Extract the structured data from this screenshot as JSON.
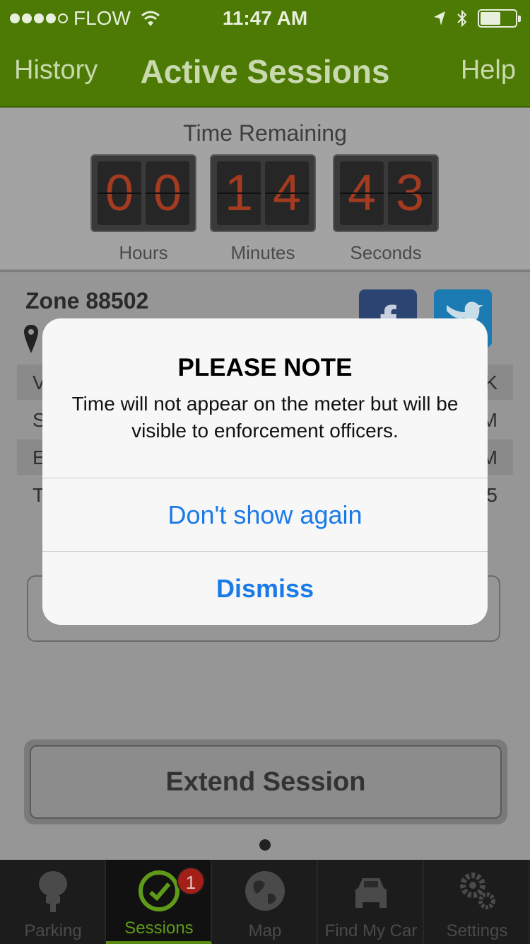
{
  "status_bar": {
    "carrier": "FLOW",
    "time": "11:47 AM",
    "signal_bars_filled": 4,
    "signal_bars_total": 5
  },
  "nav": {
    "left": "History",
    "title": "Active Sessions",
    "right": "Help"
  },
  "timer": {
    "heading": "Time Remaining",
    "hours": [
      "0",
      "0"
    ],
    "minutes": [
      "1",
      "4"
    ],
    "seconds": [
      "4",
      "3"
    ],
    "hours_label": "Hours",
    "minutes_label": "Minutes",
    "seconds_label": "Seconds"
  },
  "session": {
    "zone": "Zone 88502",
    "row_fragments": [
      {
        "left": "V",
        "right": "K"
      },
      {
        "left": "S",
        "right": "M"
      },
      {
        "left": "E",
        "right": "M"
      },
      {
        "left": "T",
        "right": "5"
      }
    ],
    "facebook_letter": "f"
  },
  "actions": {
    "extend": "Extend Session"
  },
  "alert": {
    "title": "PLEASE NOTE",
    "message": "Time will not appear on the meter but will be visible to enforcement officers.",
    "button_secondary": "Don't show again",
    "button_primary": "Dismiss"
  },
  "tabs": [
    {
      "label": "Parking",
      "icon": "parking-meter-icon"
    },
    {
      "label": "Sessions",
      "icon": "clock-check-icon",
      "badge": "1"
    },
    {
      "label": "Map",
      "icon": "globe-icon"
    },
    {
      "label": "Find My Car",
      "icon": "car-icon"
    },
    {
      "label": "Settings",
      "icon": "gears-icon"
    }
  ],
  "colors": {
    "nav_green": "#4d7a04",
    "active_tab_green": "#5f9a18",
    "alert_button_blue": "#1a7ae8",
    "badge_red": "#a32019"
  }
}
